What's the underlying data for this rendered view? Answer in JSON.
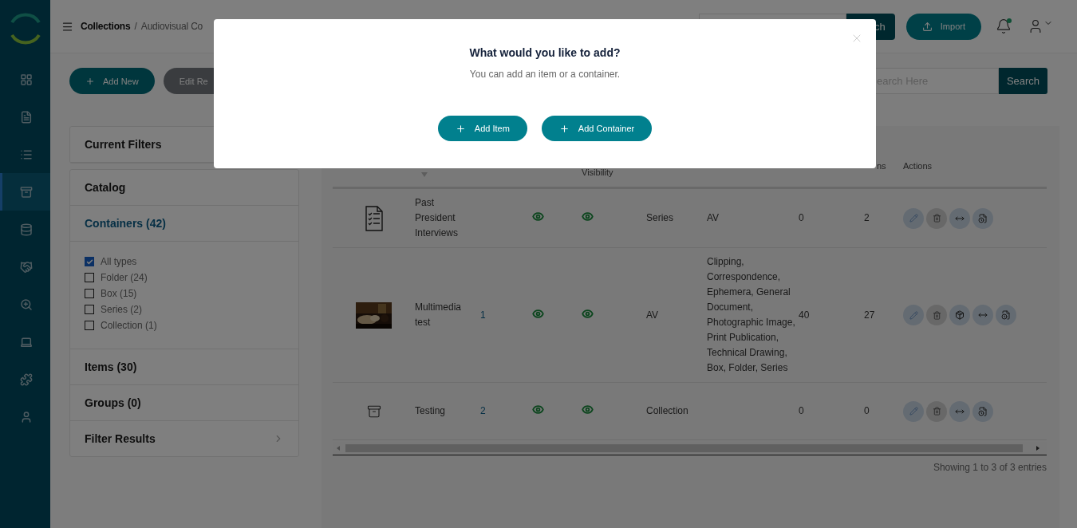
{
  "sidebar": {
    "items": [
      {
        "selected": false
      },
      {
        "selected": false
      },
      {
        "selected": false
      },
      {
        "selected": true
      },
      {
        "selected": false
      },
      {
        "selected": false
      },
      {
        "selected": false
      },
      {
        "selected": false
      },
      {
        "selected": false
      },
      {
        "selected": false
      }
    ]
  },
  "header": {
    "breadcrumb_root": "Collections",
    "breadcrumb_separator": "/",
    "breadcrumb_current": "Audiovisual Co",
    "search_button": "ch",
    "import_button": "Import",
    "notification_dot": true
  },
  "toolbar": {
    "add_new": "Add New",
    "edit": "Edit Re",
    "search_placeholder": "earch Here",
    "search_button": "Search"
  },
  "filters": {
    "current_filters": "Current Filters",
    "sections": [
      {
        "label": "Catalog",
        "active": false
      },
      {
        "label": "Containers (42)",
        "active": true,
        "options": [
          {
            "label": "All types",
            "checked": true
          },
          {
            "label": "Folder (24)",
            "checked": false
          },
          {
            "label": "Box (15)",
            "checked": false
          },
          {
            "label": "Series (2)",
            "checked": false
          },
          {
            "label": "Collection (1)",
            "checked": false
          }
        ]
      },
      {
        "label": "Items (30)",
        "active": false
      },
      {
        "label": "Groups (0)",
        "active": false
      },
      {
        "label": "Filter Results",
        "active": false,
        "chevron": true
      }
    ]
  },
  "table": {
    "columns": [
      {},
      {
        "sort_caret": true
      },
      {},
      {},
      {
        "label": "Visibility"
      },
      {},
      {},
      {},
      {
        "label": "ns"
      },
      {
        "label": "Actions"
      }
    ],
    "rows": [
      {
        "kind": "checklist",
        "title": "Past President Interviews",
        "public": true,
        "visible": true,
        "type": "Series",
        "item_types": "AV",
        "count_a": "0",
        "count_b": "2",
        "actions": [
          {
            "kind": "edit"
          },
          {
            "kind": "delete"
          },
          {
            "kind": "move"
          },
          {
            "kind": "report"
          }
        ]
      },
      {
        "kind": "picture",
        "title": "Multimedia test",
        "number": "1",
        "public": true,
        "visible": true,
        "type": "AV",
        "item_types": "Clipping, Correspondence, Ephemera, General Document, Photographic Image, Print Publication, Technical Drawing, Box, Folder, Series",
        "count_a": "40",
        "count_b": "27",
        "actions": [
          {
            "kind": "edit"
          },
          {
            "kind": "delete"
          },
          {
            "kind": "box"
          },
          {
            "kind": "move"
          },
          {
            "kind": "report"
          }
        ]
      },
      {
        "kind": "box",
        "title": "Testing",
        "number": "2",
        "public": true,
        "visible": true,
        "type": "Collection",
        "count_a": "0",
        "count_b": "0",
        "actions": [
          {
            "kind": "edit"
          },
          {
            "kind": "delete"
          },
          {
            "kind": "move"
          },
          {
            "kind": "report"
          }
        ]
      }
    ],
    "footer": "Showing 1 to 3 of 3 entries"
  },
  "modal": {
    "title": "What would you like to add?",
    "text": "You can add an item or a container.",
    "buttons": [
      "Add Item",
      "Add Container"
    ]
  }
}
